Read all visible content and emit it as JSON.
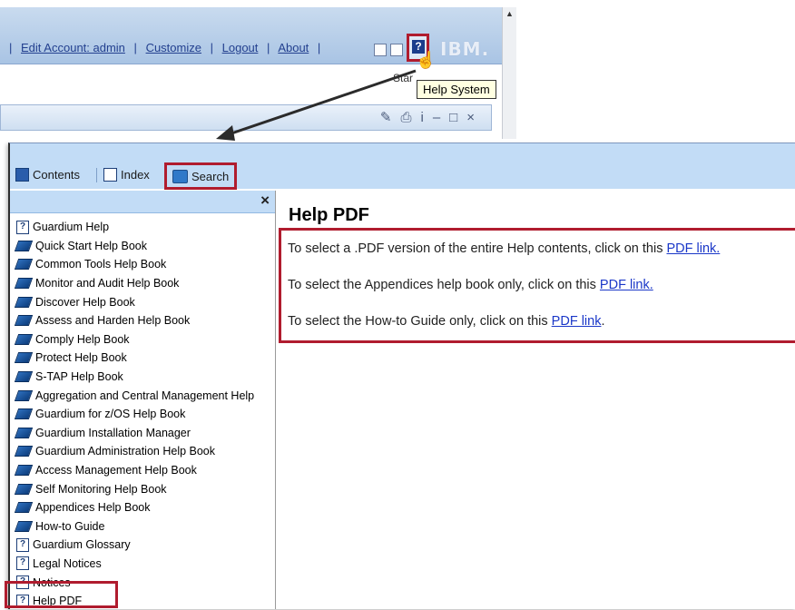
{
  "top_window": {
    "links": {
      "edit_account": "Edit Account: admin",
      "customize": "Customize",
      "logout": "Logout",
      "about": "About",
      "separator": "|"
    },
    "brand": "IBM.",
    "partial_label": "Star",
    "tooltip": "Help System",
    "help_button_glyph": "?",
    "toolbar_icons": [
      "pencil-icon",
      "print-icon",
      "info-icon",
      "minimize-icon",
      "maximize-icon",
      "close-icon"
    ]
  },
  "help": {
    "tabs": {
      "contents": "Contents",
      "index": "Index",
      "search": "Search"
    },
    "close_label": "×",
    "toc": [
      {
        "label": "Guardium Help",
        "icon": "help-page-icon"
      },
      {
        "label": "Quick Start Help Book",
        "icon": "book-icon"
      },
      {
        "label": "Common Tools Help Book",
        "icon": "book-icon"
      },
      {
        "label": "Monitor and Audit Help Book",
        "icon": "book-icon"
      },
      {
        "label": "Discover Help Book",
        "icon": "book-icon"
      },
      {
        "label": "Assess and Harden Help Book",
        "icon": "book-icon"
      },
      {
        "label": "Comply Help Book",
        "icon": "book-icon"
      },
      {
        "label": "Protect Help Book",
        "icon": "book-icon"
      },
      {
        "label": "S-TAP Help Book",
        "icon": "book-icon"
      },
      {
        "label": "Aggregation and Central Management Help",
        "icon": "book-icon"
      },
      {
        "label": "Guardium for z/OS Help Book",
        "icon": "book-icon"
      },
      {
        "label": "Guardium Installation Manager",
        "icon": "book-icon"
      },
      {
        "label": "Guardium Administration Help Book",
        "icon": "book-icon"
      },
      {
        "label": "Access Management Help Book",
        "icon": "book-icon"
      },
      {
        "label": "Self Monitoring Help Book",
        "icon": "book-icon"
      },
      {
        "label": "Appendices Help Book",
        "icon": "book-icon"
      },
      {
        "label": "How-to Guide",
        "icon": "book-icon"
      },
      {
        "label": "Guardium Glossary",
        "icon": "help-page-icon"
      },
      {
        "label": "Legal Notices",
        "icon": "help-page-icon"
      },
      {
        "label": "Notices",
        "icon": "help-page-icon"
      },
      {
        "label": "Help PDF",
        "icon": "help-page-icon"
      }
    ],
    "content": {
      "title": "Help PDF",
      "lines": [
        {
          "text": "To select a .PDF version of the entire Help contents, click on this ",
          "link": "PDF link."
        },
        {
          "text": "To select the Appendices help book only, click on this ",
          "link": "PDF link."
        },
        {
          "text": "To select the How-to Guide only, click on this ",
          "link": "PDF link",
          "suffix": "."
        }
      ]
    }
  },
  "colors": {
    "highlight_red": "#b01c2e",
    "link_blue": "#1a37c8",
    "header_blue": "#c2dcf6"
  }
}
